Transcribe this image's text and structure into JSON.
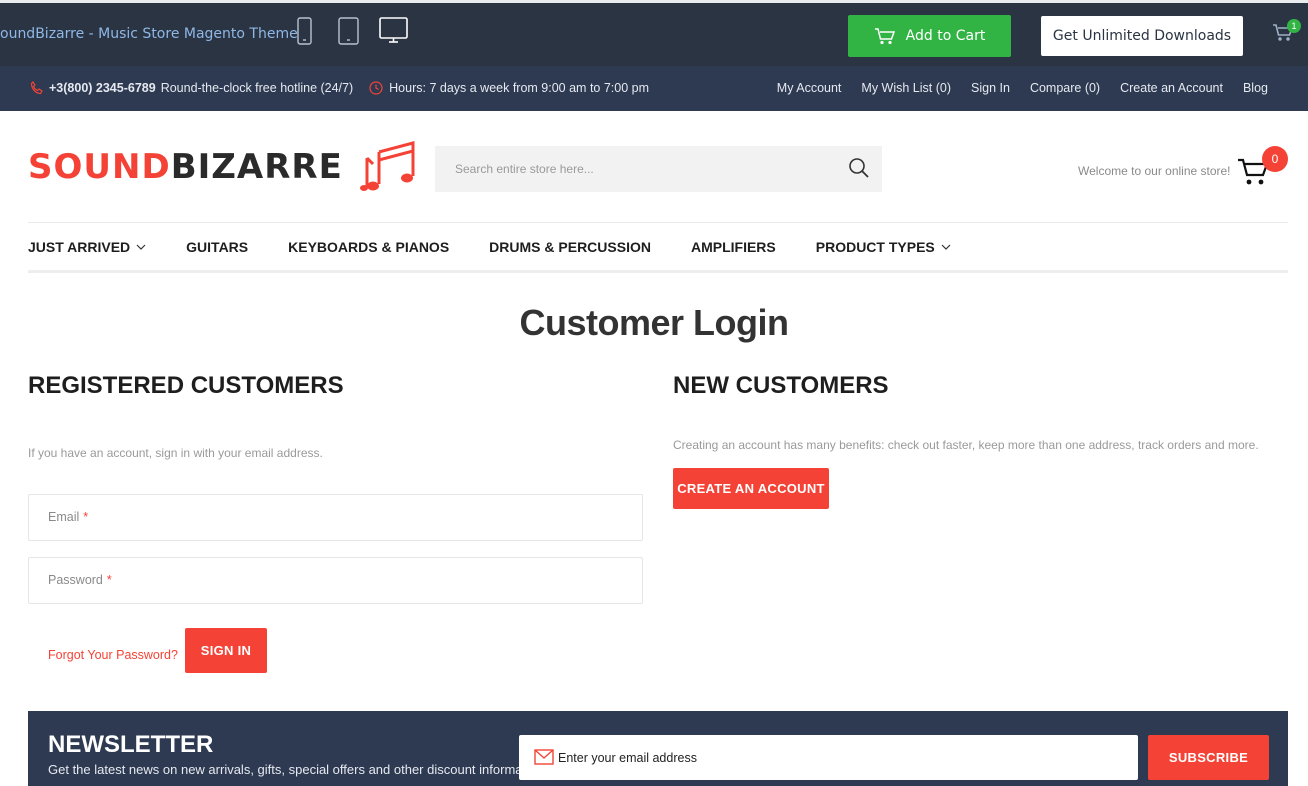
{
  "demo_bar": {
    "title": "oundBizarre - Music Store Magento Theme",
    "add_to_cart": "Add to Cart",
    "unlimited": "Get Unlimited Downloads",
    "cart_count": "1",
    "accent_green": "#32b445"
  },
  "info_bar": {
    "phone": "+3(800) 2345-6789",
    "hotline_text": "Round-the-clock free hotline (24/7)",
    "hours": "Hours: 7 days a week from 9:00 am to 7:00 pm",
    "links": [
      "My Account",
      "My Wish List (0)",
      "Sign In",
      "Compare (0)",
      "Create an Account",
      "Blog"
    ]
  },
  "header": {
    "logo_part1": "SOUND",
    "logo_part2": "BIZARRE",
    "search_placeholder": "Search entire store here...",
    "welcome": "Welcome to our online store!",
    "cart_count": "0",
    "brand_red": "#f44336"
  },
  "nav": {
    "items": [
      {
        "label": "JUST ARRIVED",
        "dropdown": true
      },
      {
        "label": "GUITARS",
        "dropdown": false
      },
      {
        "label": "KEYBOARDS & PIANOS",
        "dropdown": false
      },
      {
        "label": "DRUMS & PERCUSSION",
        "dropdown": false
      },
      {
        "label": "AMPLIFIERS",
        "dropdown": false
      },
      {
        "label": "PRODUCT TYPES",
        "dropdown": true
      }
    ]
  },
  "page": {
    "title": "Customer Login"
  },
  "registered": {
    "title": "REGISTERED CUSTOMERS",
    "note": "If you have an account, sign in with your email address.",
    "email_label": "Email",
    "password_label": "Password",
    "required_mark": "*",
    "forgot": "Forgot Your Password?",
    "sign_in": "SIGN IN"
  },
  "new_customers": {
    "title": "NEW CUSTOMERS",
    "note": "Creating an account has many benefits: check out faster, keep more than one address, track orders and more.",
    "create_button": "CREATE AN ACCOUNT"
  },
  "newsletter": {
    "title": "NEWSLETTER",
    "description": "Get the latest news on new arrivals, gifts, special offers and other discount information.",
    "placeholder": "Enter your email address",
    "subscribe": "SUBSCRIBE"
  }
}
